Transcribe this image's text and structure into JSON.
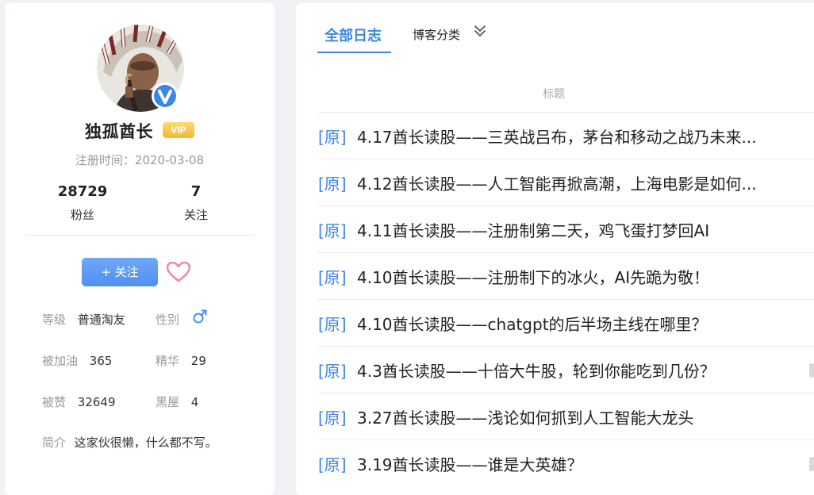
{
  "profile": {
    "name": "独孤酋长",
    "vip": "VIP",
    "reg_time": "注册时间：2020-03-08",
    "fans_count": "28729",
    "fans_label": "粉丝",
    "follow_count": "7",
    "follow_label": "关注",
    "follow_button": "+ 关注",
    "level_key": "等级",
    "level_val": "普通淘友",
    "gender_key": "性别",
    "oil_key": "被加油",
    "oil_val": "365",
    "essence_key": "精华",
    "essence_val": "29",
    "likes_key": "被赞",
    "likes_val": "32649",
    "blackhouse_key": "黑屋",
    "blackhouse_val": "4",
    "intro_key": "简介",
    "intro_val": "这家伙很懒，什么都不写。"
  },
  "tabs": {
    "all": "全部日志",
    "category": "博客分类"
  },
  "list": {
    "header": "标题",
    "posts": [
      {
        "tag": "[原]",
        "title": "4.17酋长读股——三英战吕布，茅台和移动之战乃未来..."
      },
      {
        "tag": "[原]",
        "title": "4.12酋长读股——人工智能再掀高潮，上海电影是如何..."
      },
      {
        "tag": "[原]",
        "title": "4.11酋长读股——注册制第二天，鸡飞蛋打梦回AI"
      },
      {
        "tag": "[原]",
        "title": "4.10酋长读股——注册制下的冰火，AI先跪为敬！"
      },
      {
        "tag": "[原]",
        "title": "4.10酋长读股——chatgpt的后半场主线在哪里？"
      },
      {
        "tag": "[原]",
        "title": "4.3酋长读股——十倍大牛股，轮到你能吃到几份？"
      },
      {
        "tag": "[原]",
        "title": "3.27酋长读股——浅论如何抓到人工智能大龙头"
      },
      {
        "tag": "[原]",
        "title": "3.19酋长读股——谁是大英雄？"
      }
    ]
  },
  "colors": {
    "accent": "#3d86e6",
    "vip_gold": "#f5b73a",
    "heart": "#f08a96",
    "gender": "#4a8ef0"
  },
  "icons": {
    "verify": "verified-v-icon",
    "heart": "heart-icon",
    "gender": "male-icon",
    "chevron": "double-chevron-down-icon"
  }
}
